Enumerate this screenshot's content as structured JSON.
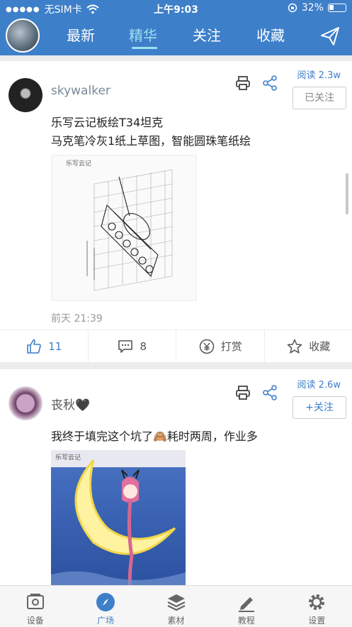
{
  "status": {
    "carrier": "无SIM卡",
    "time": "上午9:03",
    "battery": "32%"
  },
  "nav": {
    "tabs": [
      {
        "label": "最新"
      },
      {
        "label": "精华"
      },
      {
        "label": "关注"
      },
      {
        "label": "收藏"
      }
    ],
    "active_index": 1
  },
  "posts": [
    {
      "username": "skywalker",
      "reads": "阅读 2.3w",
      "follow_label": "已关注",
      "text_line1": "乐写云记板绘T34坦克",
      "text_line2": "马克笔冷灰1纸上草图，智能圆珠笔纸绘",
      "image_logo": "乐写云记",
      "timestamp": "前天 21:39",
      "likes": "11",
      "comments": "8",
      "tip_label": "打赏",
      "fav_label": "收藏"
    },
    {
      "username": "丧秋🖤",
      "reads": "阅读 2.6w",
      "follow_label": "+关注",
      "text_line1": "我终于填完这个坑了🙈耗时两周，作业多",
      "image_logo": "乐写云记"
    }
  ],
  "tabbar": {
    "items": [
      {
        "label": "设备",
        "icon": "device-icon"
      },
      {
        "label": "广场",
        "icon": "compass-icon"
      },
      {
        "label": "素材",
        "icon": "layers-icon"
      },
      {
        "label": "教程",
        "icon": "pen-icon"
      },
      {
        "label": "设置",
        "icon": "gear-icon"
      }
    ],
    "active_index": 1
  },
  "colors": {
    "brand": "#3d7fc9",
    "active_tab": "#9fe0f0"
  }
}
